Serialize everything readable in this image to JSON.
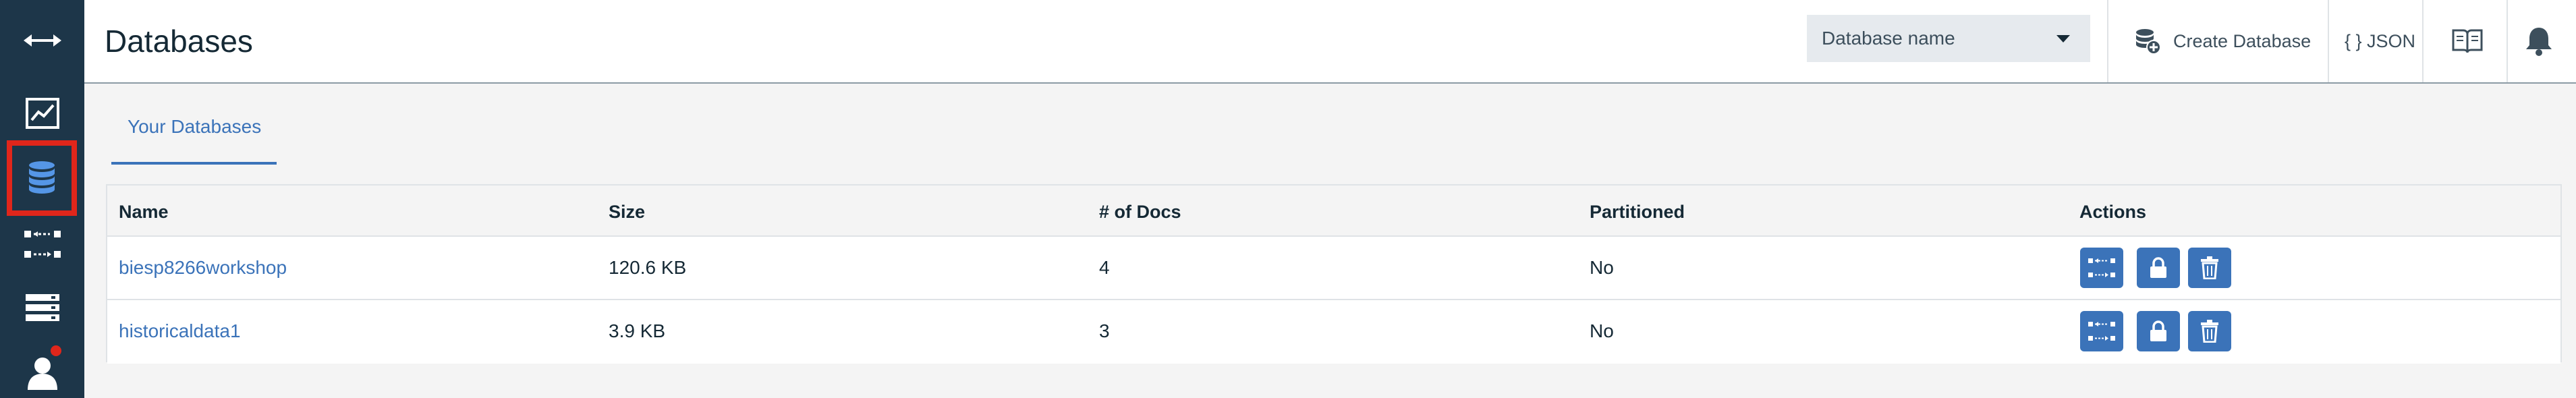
{
  "sidebar": {
    "items": [
      {
        "icon": "collapse-arrows-icon",
        "selected": false
      },
      {
        "icon": "activity-chart-icon",
        "selected": false
      },
      {
        "icon": "database-icon",
        "selected": true
      },
      {
        "icon": "replication-icon",
        "selected": false
      },
      {
        "icon": "server-list-icon",
        "selected": false
      },
      {
        "icon": "user-icon",
        "selected": false,
        "notification": true
      }
    ],
    "accent": "#e0261b"
  },
  "header": {
    "title": "Databases",
    "database_select": {
      "placeholder": "Database name"
    },
    "create_button_label": "Create Database",
    "json_button_label": "{ } JSON",
    "docs_icon": "book-icon",
    "notifications_icon": "bell-icon"
  },
  "tabs": [
    {
      "label": "Your Databases",
      "active": true
    }
  ],
  "table": {
    "columns": [
      "Name",
      "Size",
      "# of Docs",
      "Partitioned",
      "Actions"
    ],
    "rows": [
      {
        "name": "biesp8266workshop",
        "size": "120.6 KB",
        "docs": "4",
        "partitioned": "No"
      },
      {
        "name": "historicaldata1",
        "size": "3.9 KB",
        "docs": "3",
        "partitioned": "No"
      }
    ],
    "actions": [
      "replicate-icon",
      "lock-icon",
      "trash-icon"
    ]
  },
  "colors": {
    "sidebar_bg": "#1d3649",
    "link": "#3b73b9",
    "action_button": "#3b73b9"
  }
}
